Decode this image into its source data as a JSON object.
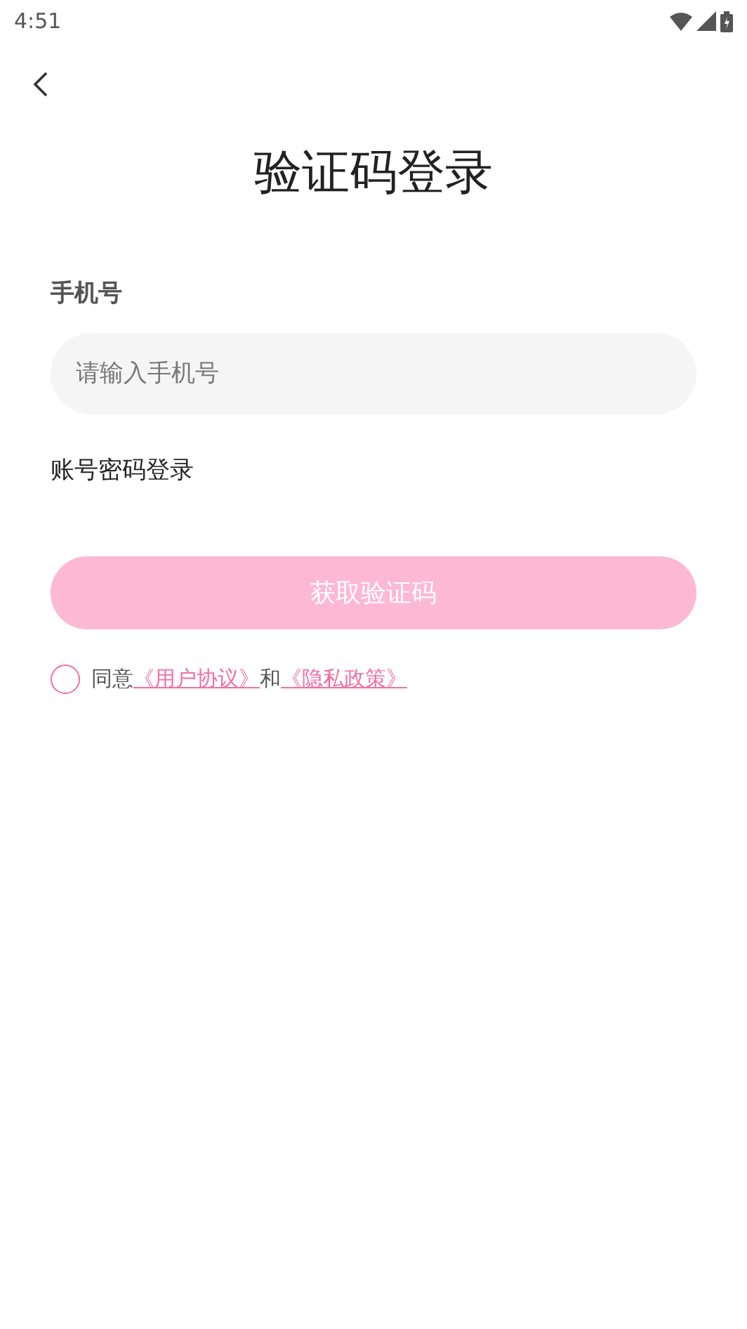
{
  "status_bar": {
    "time": "4:51"
  },
  "title": "验证码登录",
  "phone": {
    "label": "手机号",
    "placeholder": "请输入手机号"
  },
  "alt_login": "账号密码登录",
  "submit": {
    "label": "获取验证码",
    "disabled": true
  },
  "agreement": {
    "checked": false,
    "prefix": "同意",
    "links": [
      "《用户协议》",
      "《隐私政策》"
    ],
    "joiner": "和"
  }
}
